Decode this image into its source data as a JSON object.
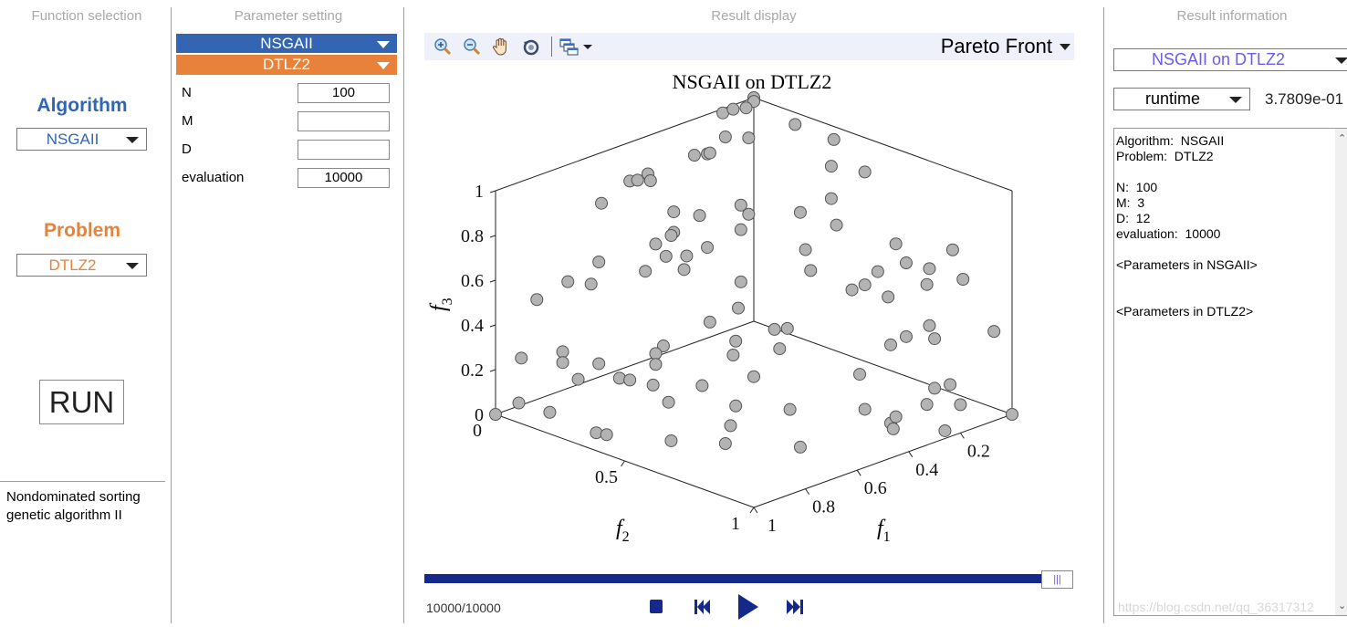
{
  "function_panel": {
    "title": "Function selection",
    "algorithm_label": "Algorithm",
    "algorithm_value": "NSGAII",
    "problem_label": "Problem",
    "problem_value": "DTLZ2",
    "run_label": "RUN",
    "description": "Nondominated sorting genetic algorithm II",
    "colors": {
      "algorithm": "#2f66b8",
      "problem": "#e8823a"
    }
  },
  "parameter_panel": {
    "title": "Parameter setting",
    "algorithm_bar": "NSGAII",
    "problem_bar": "DTLZ2",
    "params": [
      {
        "label": "N",
        "value": "100"
      },
      {
        "label": "M",
        "value": ""
      },
      {
        "label": "D",
        "value": ""
      },
      {
        "label": "evaluation",
        "value": "10000"
      }
    ]
  },
  "display_panel": {
    "title": "Result display",
    "toolbar": {
      "icons": [
        "zoom-in-icon",
        "zoom-out-icon",
        "pan-hand-icon",
        "rotate-3d-icon",
        "figure-windows-icon"
      ],
      "view_select": "Pareto Front"
    },
    "progress": {
      "label": "10000/10000",
      "current": 10000,
      "total": 10000,
      "fraction": 1.0,
      "color": "#14298a"
    },
    "controls": [
      "stop-icon",
      "step-back-icon",
      "play-icon",
      "step-forward-icon"
    ]
  },
  "chart_data": {
    "type": "scatter",
    "dimensions": 3,
    "title": "NSGAII on DTLZ2",
    "xlabel": "f1",
    "ylabel": "f2",
    "zlabel": "f3",
    "xlim": [
      0,
      1
    ],
    "ylim": [
      0,
      1
    ],
    "zlim": [
      0,
      1
    ],
    "x_ticks": [
      "1",
      "0.8",
      "0.6",
      "0.4",
      "0.2"
    ],
    "x_tick_values": [
      1,
      0.8,
      0.6,
      0.4,
      0.2
    ],
    "y_ticks": [
      "0",
      "0.5",
      "1"
    ],
    "y_tick_values": [
      0,
      0.5,
      1
    ],
    "z_ticks": [
      "0",
      "0.2",
      "0.4",
      "0.6",
      "0.8",
      "1"
    ],
    "z_tick_values": [
      0,
      0.2,
      0.4,
      0.6,
      0.8,
      1
    ],
    "grid": false,
    "marker_color": "#b3b3b3",
    "points": [
      [
        0,
        0,
        1
      ],
      [
        0.02,
        0.02,
        1.0
      ],
      [
        0.13,
        0.01,
        0.99
      ],
      [
        0.09,
        0.01,
        0.99
      ],
      [
        0.07,
        0.04,
        1.0
      ],
      [
        0.23,
        0.12,
        0.97
      ],
      [
        0.19,
        0.17,
        0.97
      ],
      [
        0.34,
        0.11,
        0.93
      ],
      [
        0.32,
        0.14,
        0.94
      ],
      [
        0.31,
        0.14,
        0.94
      ],
      [
        0.52,
        0.04,
        0.86
      ],
      [
        0.5,
        0.05,
        0.86
      ],
      [
        0.47,
        0.06,
        0.88
      ],
      [
        0.49,
        0.09,
        0.87
      ],
      [
        0.61,
        0.02,
        0.79
      ],
      [
        0.54,
        0.23,
        0.81
      ],
      [
        0.51,
        0.3,
        0.81
      ],
      [
        0.41,
        0.36,
        0.84
      ],
      [
        0.42,
        0.4,
        0.82
      ],
      [
        0.47,
        0.42,
        0.78
      ],
      [
        0.59,
        0.28,
        0.76
      ],
      [
        0.6,
        0.28,
        0.75
      ],
      [
        0.64,
        0.26,
        0.72
      ],
      [
        0.65,
        0.31,
        0.69
      ],
      [
        0.62,
        0.36,
        0.7
      ],
      [
        0.57,
        0.39,
        0.73
      ],
      [
        0.75,
        0.15,
        0.64
      ],
      [
        0.71,
        0.29,
        0.64
      ],
      [
        0.65,
        0.38,
        0.66
      ],
      [
        0.57,
        0.52,
        0.63
      ],
      [
        0.82,
        0.1,
        0.56
      ],
      [
        0.8,
        0.17,
        0.57
      ],
      [
        0.88,
        0.04,
        0.48
      ],
      [
        0.62,
        0.56,
        0.55
      ],
      [
        0.69,
        0.52,
        0.5
      ],
      [
        0.67,
        0.6,
        0.44
      ],
      [
        0.69,
        0.61,
        0.39
      ],
      [
        0.67,
        0.67,
        0.31
      ],
      [
        0.8,
        0.45,
        0.41
      ],
      [
        0.82,
        0.44,
        0.38
      ],
      [
        0.83,
        0.45,
        0.34
      ],
      [
        0.96,
        0.06,
        0.26
      ],
      [
        0.93,
        0.19,
        0.33
      ],
      [
        0.94,
        0.2,
        0.29
      ],
      [
        0.9,
        0.3,
        0.31
      ],
      [
        0.94,
        0.26,
        0.24
      ],
      [
        0.89,
        0.37,
        0.27
      ],
      [
        0.88,
        0.4,
        0.27
      ],
      [
        0.85,
        0.46,
        0.26
      ],
      [
        0.77,
        0.57,
        0.27
      ],
      [
        0.84,
        0.51,
        0.2
      ],
      [
        0.73,
        0.66,
        0.2
      ],
      [
        0.75,
        0.66,
        0.12
      ],
      [
        0.76,
        0.65,
        0.04
      ],
      [
        0.85,
        0.53,
        0.04
      ],
      [
        0.94,
        0.33,
        0.03
      ],
      [
        0.93,
        0.36,
        0.03
      ],
      [
        0.98,
        0.19,
        0.08
      ],
      [
        0.99,
        0.08,
        0.08
      ],
      [
        1,
        0,
        0
      ],
      [
        0.04,
        0.2,
        0.98
      ],
      [
        0.01,
        0.32,
        0.95
      ],
      [
        0.11,
        0.41,
        0.91
      ],
      [
        0.04,
        0.47,
        0.88
      ],
      [
        0.2,
        0.5,
        0.84
      ],
      [
        0.31,
        0.49,
        0.82
      ],
      [
        0.26,
        0.58,
        0.78
      ],
      [
        0.38,
        0.58,
        0.72
      ],
      [
        0.15,
        0.7,
        0.7
      ],
      [
        0.0,
        0.77,
        0.64
      ],
      [
        0.16,
        0.75,
        0.64
      ],
      [
        0.41,
        0.63,
        0.66
      ],
      [
        0.25,
        0.73,
        0.63
      ],
      [
        0.11,
        0.79,
        0.61
      ],
      [
        0.03,
        0.84,
        0.55
      ],
      [
        0.35,
        0.73,
        0.59
      ],
      [
        0.31,
        0.74,
        0.6
      ],
      [
        0.14,
        0.81,
        0.56
      ],
      [
        0.27,
        0.79,
        0.55
      ],
      [
        0.58,
        0.66,
        0.48
      ],
      [
        0.55,
        0.68,
        0.48
      ],
      [
        0.59,
        0.69,
        0.41
      ],
      [
        0.44,
        0.85,
        0.3
      ],
      [
        0.33,
        0.86,
        0.39
      ],
      [
        0.28,
        0.87,
        0.41
      ],
      [
        0.2,
        0.88,
        0.43
      ],
      [
        0.2,
        0.9,
        0.38
      ],
      [
        0.01,
        0.94,
        0.35
      ],
      [
        0.25,
        0.95,
        0.2
      ],
      [
        0.2,
        0.96,
        0.2
      ],
      [
        0.28,
        0.95,
        0.14
      ],
      [
        0.18,
        0.98,
        0.11
      ],
      [
        0.62,
        0.76,
        0.18
      ],
      [
        0.45,
        0.88,
        0.16
      ],
      [
        0.39,
        0.92,
        0.09
      ],
      [
        0.37,
        0.92,
        0.11
      ],
      [
        0.38,
        0.92,
        0.06
      ],
      [
        0.23,
        0.97,
        0.01
      ],
      [
        0.61,
        0.79,
        0.02
      ],
      [
        0,
        1,
        0
      ]
    ]
  },
  "result_panel": {
    "title": "Result information",
    "result_select": "NSGAII on DTLZ2",
    "metric_select": "runtime",
    "metric_value": "3.7809e-01",
    "info_lines": [
      "Algorithm:  NSGAII",
      "Problem:  DTLZ2",
      "",
      "N:  100",
      "M:  3",
      "D:  12",
      "evaluation:  10000",
      "",
      "<Parameters in NSGAII>",
      "",
      "",
      "<Parameters in DTLZ2>"
    ],
    "watermark": "https://blog.csdn.net/qq_36317312",
    "select_color": "#6b5cf0"
  }
}
